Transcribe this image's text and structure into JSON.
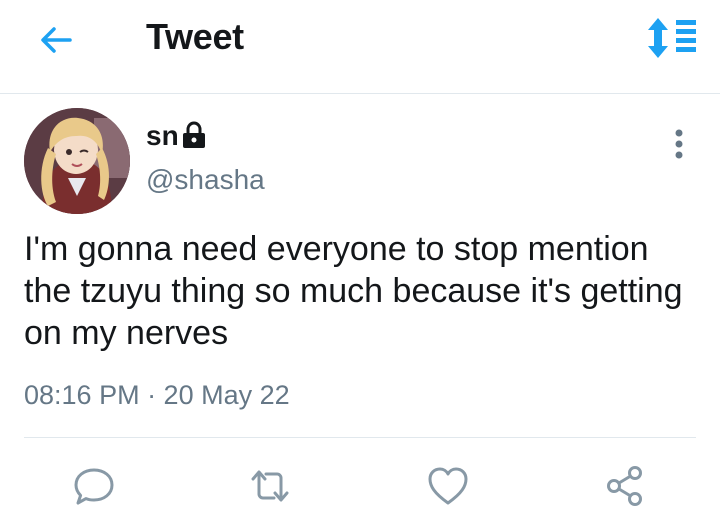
{
  "header": {
    "title": "Tweet",
    "back_icon": "arrow-left-icon",
    "sort_icon": "sort-updown-icon"
  },
  "tweet": {
    "display_name": "sn",
    "protected_icon": "lock-icon",
    "handle": "@shasha",
    "text": "I'm gonna need everyone to stop mention the tzuyu thing so much because it's getting on my nerves",
    "timestamp": "08:16 PM · 20 May 22",
    "more_icon": "more-vertical-icon"
  },
  "actions": [
    "reply-icon",
    "retweet-icon",
    "like-icon",
    "share-icon"
  ],
  "colors": {
    "accent": "#1da1f2",
    "text": "#14171a",
    "secondary_text": "#657786",
    "icon_gray": "#8899a6",
    "divider": "#e1e8ed"
  }
}
